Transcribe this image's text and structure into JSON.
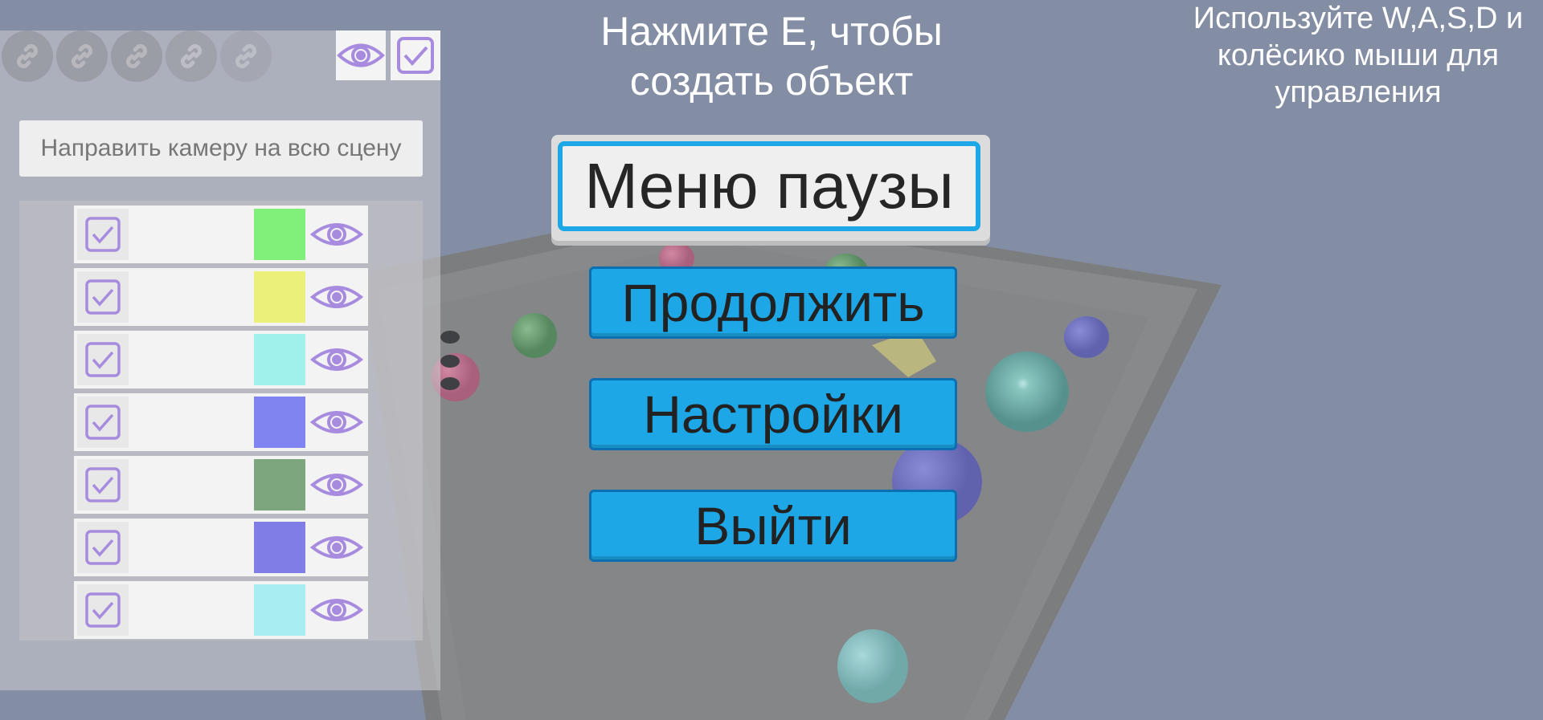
{
  "hints": {
    "create_object": "Нажмите E, чтобы создать объект",
    "controls": "Используйте W,A,S,D и колёсико мыши для управления"
  },
  "left_panel": {
    "link_icons": [
      "link-icon",
      "link-icon",
      "link-icon",
      "link-icon",
      "link-icon"
    ],
    "visibility_toggle_icon": "eye-icon",
    "select_all_checked": true,
    "focus_camera_label": "Направить камеру на всю сцену",
    "objects": [
      {
        "checked": true,
        "color": "#80f07a",
        "visible": true
      },
      {
        "checked": true,
        "color": "#eaf07a",
        "visible": true
      },
      {
        "checked": true,
        "color": "#a0f0ec",
        "visible": true
      },
      {
        "checked": true,
        "color": "#8084f0",
        "visible": true
      },
      {
        "checked": true,
        "color": "#7ea67e",
        "visible": true
      },
      {
        "checked": true,
        "color": "#807ee6",
        "visible": true
      },
      {
        "checked": true,
        "color": "#a8eef0",
        "visible": true
      }
    ]
  },
  "pause_menu": {
    "title": "Меню паузы",
    "resume_label": "Продолжить",
    "settings_label": "Настройки",
    "exit_label": "Выйти"
  },
  "colors": {
    "accent": "#1ea7e6",
    "accent_border": "#0b6fb1",
    "icon_purple": "#a78bde",
    "background": "#8590a6"
  }
}
